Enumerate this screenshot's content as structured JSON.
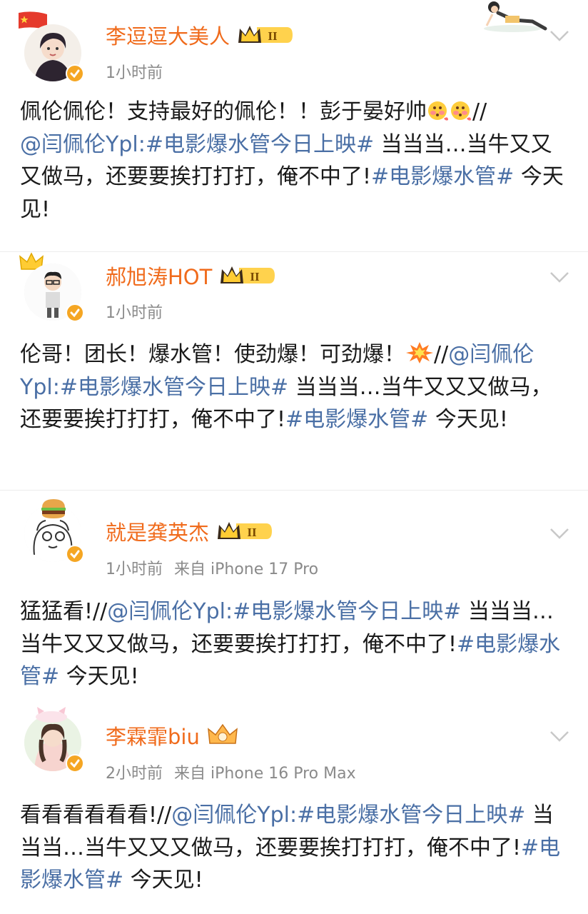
{
  "colors": {
    "name": "#f06b1c",
    "link": "#4a6fa5",
    "meta": "#8a8a8a",
    "verified": "#f5a623"
  },
  "posts": [
    {
      "name": "李逗逗大美人",
      "time": "1小时前",
      "source": "",
      "text1": "佩伦佩伦！支持最好的佩伦！！彭于晏好帅",
      "text2": "//",
      "link1": "@闫佩伦Ypl:",
      "link2": "#电影爆水管今日上映#",
      "text3": " 当当当…当牛又又又做马，还要要挨打打打，俺不中了!",
      "link3": "#电影爆水管#",
      "text4": " 今天见!",
      "icons": [
        "china-flag-icon",
        "flushed-face-emoji",
        "flushed-face-emoji"
      ]
    },
    {
      "name": "郝旭涛HOT",
      "time": "1小时前",
      "source": "",
      "text1": "伦哥！团长！爆水管！使劲爆！可劲爆！",
      "text2": "//",
      "link1": "@闫佩伦Ypl:",
      "link2": "#电影爆水管今日上映#",
      "text3": " 当当当…当牛又又又做马，还要要挨打打打，俺不中了!",
      "link3": "#电影爆水管#",
      "text4": " 今天见!",
      "icons": [
        "crown-icon",
        "explosion-emoji"
      ]
    },
    {
      "name": "就是龚英杰",
      "time": "1小时前",
      "source": "来自 iPhone 17 Pro",
      "text1": "猛猛看!",
      "text2": "//",
      "link1": "@闫佩伦Ypl:",
      "link2": "#电影爆水管今日上映#",
      "text3": " 当当当…当牛又又又做马，还要要挨打打打，俺不中了!",
      "link3": "#电影爆水管#",
      "text4": " 今天见!",
      "icons": [
        "burger-icon"
      ]
    },
    {
      "name": "李霖霏biu",
      "time": "2小时前",
      "source": "来自 iPhone 16 Pro Max",
      "text1": "看看看看看看!",
      "text2": "//",
      "link1": "@闫佩伦Ypl:",
      "link2": "#电影爆水管今日上映#",
      "text3": " 当当当…当牛又又又做马，还要要挨打打打，俺不中了!",
      "link3": "#电影爆水管#",
      "text4": " 今天见!",
      "icons": [
        "crown-badge-icon"
      ]
    }
  ]
}
